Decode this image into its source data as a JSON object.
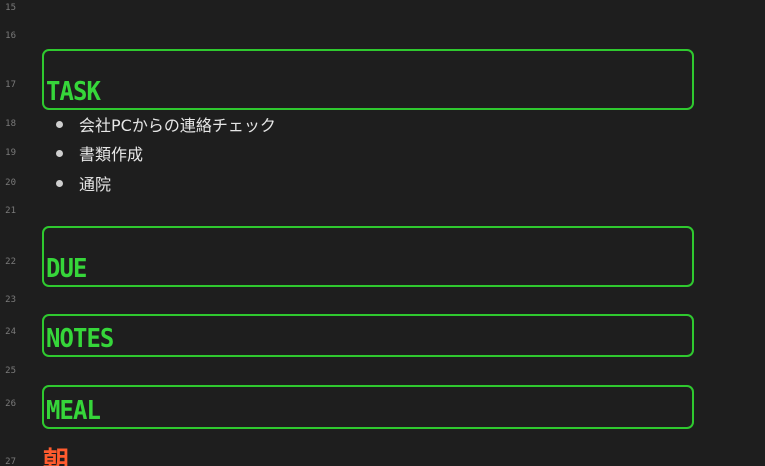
{
  "gutter": {
    "lines": [
      "15",
      "16",
      "17",
      "18",
      "19",
      "20",
      "21",
      "22",
      "23",
      "24",
      "25",
      "26",
      "27"
    ]
  },
  "sections": {
    "task": "TASK",
    "due": "DUE",
    "notes": "NOTES",
    "meal": "MEAL"
  },
  "task_items": [
    "会社PCからの連絡チェック",
    "書類作成",
    "通院"
  ],
  "meal_subheading": "朝",
  "colors": {
    "background": "#1e1e1e",
    "heading_green": "#36d63a",
    "box_border": "#2fc92f",
    "subheading_orange": "#ff5b2e",
    "text": "#e6e6e6",
    "line_number": "#7a7a7a"
  }
}
